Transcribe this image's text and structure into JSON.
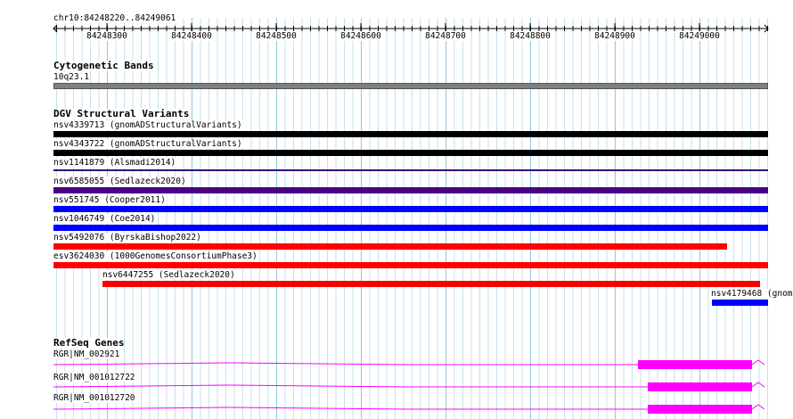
{
  "ruler": {
    "location": "chr10:84248220..84249061",
    "ticks": [
      "84248300",
      "84248400",
      "84248500",
      "84248600",
      "84248700",
      "84248800",
      "84248900",
      "84249000"
    ]
  },
  "cytoband": {
    "title": "Cytogenetic Bands",
    "band_label": "10q23.1",
    "band_color": "#808080"
  },
  "dgv": {
    "title": "DGV Structural Variants",
    "variants": [
      {
        "label": "nsv4339713 (gnomADStructuralVariants)",
        "color": "#000000"
      },
      {
        "label": "nsv4343722 (gnomADStructuralVariants)",
        "color": "#000000"
      },
      {
        "label": "nsv1141879 (Alsmadi2014)",
        "color": "#3b007a"
      },
      {
        "label": "nsv6585055 (Sedlazeck2020)",
        "color": "#4b0082"
      },
      {
        "label": "nsv551745 (Cooper2011)",
        "color": "#0000ff"
      },
      {
        "label": "nsv1046749 (Coe2014)",
        "color": "#0000ff"
      },
      {
        "label": "nsv5492076 (ByrskaBishop2022)",
        "color": "#ff0000"
      },
      {
        "label": "esv3624030 (1000GenomesConsortiumPhase3)",
        "color": "#ff0000"
      },
      {
        "label": "nsv6447255 (Sedlazeck2020)",
        "color": "#ff0000"
      },
      {
        "label": "nsv4179468 (gnom",
        "color": "#0000ff"
      }
    ]
  },
  "refseq": {
    "title": "RefSeq Genes",
    "gene_color": "#ff00ff",
    "genes": [
      {
        "label": "RGR|NM_002921"
      },
      {
        "label": "RGR|NM_001012722"
      },
      {
        "label": "RGR|NM_001012720"
      }
    ]
  }
}
